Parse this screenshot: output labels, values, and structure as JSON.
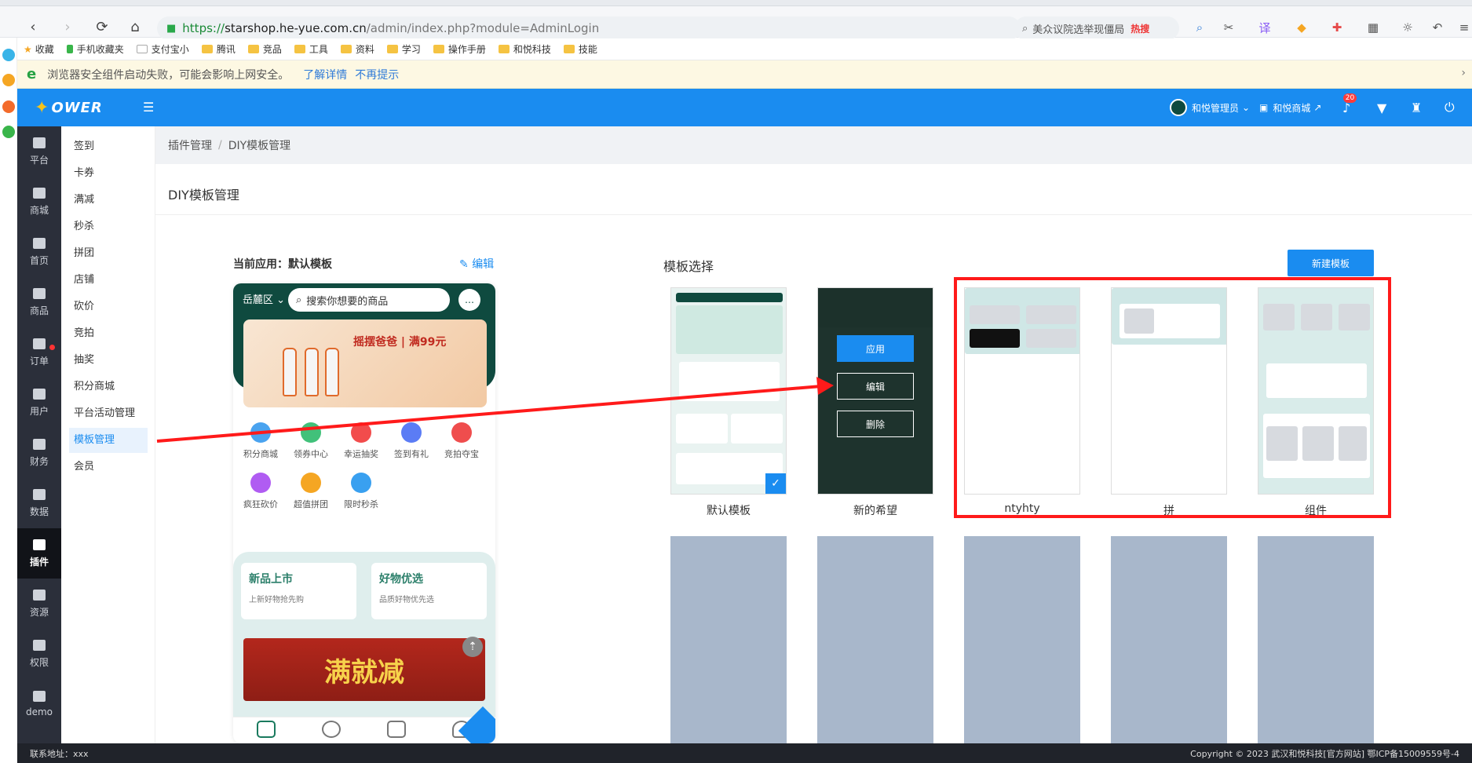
{
  "browser": {
    "url_scheme": "https://",
    "url_host": "starshop.he-yue.com.cn",
    "url_path": "/admin/index.php?module=AdminLogin",
    "search_text": "美众议院选举现僵局",
    "search_hot": "热搜",
    "bookmarks": [
      "收藏",
      "手机收藏夹",
      "支付宝小",
      "腾讯",
      "竞品",
      "工具",
      "资料",
      "学习",
      "操作手册",
      "和悦科技",
      "技能"
    ],
    "notice_text": "浏览器安全组件启动失败，可能会影响上网安全。",
    "notice_link1": "了解详情",
    "notice_link2": "不再提示"
  },
  "header": {
    "logo": "OWER",
    "user": "和悦管理员",
    "shop": "和悦商城",
    "notif_count": "20"
  },
  "sidebar": {
    "items": [
      "平台",
      "商城",
      "首页",
      "商品",
      "订单",
      "用户",
      "财务",
      "数据",
      "插件",
      "资源",
      "权限",
      "demo"
    ]
  },
  "submenu": {
    "items": [
      "签到",
      "卡券",
      "满减",
      "秒杀",
      "拼团",
      "店铺",
      "砍价",
      "竞拍",
      "抽奖",
      "积分商城",
      "平台活动管理",
      "模板管理",
      "会员"
    ]
  },
  "breadcrumb": {
    "parent": "插件管理",
    "current": "DIY模板管理"
  },
  "page": {
    "title": "DIY模板管理",
    "current_app_label": "当前应用：默认模板",
    "edit_label": "编辑",
    "template_select": "模板选择",
    "new_template": "新建模板"
  },
  "phone": {
    "location": "岳麓区",
    "search_placeholder": "搜索你想要的商品",
    "banner_text": "摇摆爸爸 | 满99元",
    "icons_row1": [
      "积分商城",
      "领券中心",
      "幸运抽奖",
      "签到有礼",
      "竞拍夺宝"
    ],
    "icons_row2": [
      "疯狂砍价",
      "超值拼团",
      "限时秒杀"
    ],
    "promo1_title": "新品上市",
    "promo1_sub": "上新好物抢先购",
    "promo2_title": "好物优选",
    "promo2_sub": "品质好物优先选",
    "sale_text": "满就减"
  },
  "templates": {
    "names": [
      "默认模板",
      "新的希望",
      "ntyhty",
      "拼",
      "组件"
    ],
    "overlay_apply": "应用",
    "overlay_edit": "编辑",
    "overlay_delete": "删除"
  },
  "footer": {
    "left": "联系地址：xxx",
    "right": "Copyright © 2023 武汉和悦科技[官方网站]  鄂ICP备15009559号-4"
  },
  "colors": {
    "primary": "#1a8cf0",
    "sidebar": "#2b2f3a",
    "highlight": "#ff1a1a"
  }
}
